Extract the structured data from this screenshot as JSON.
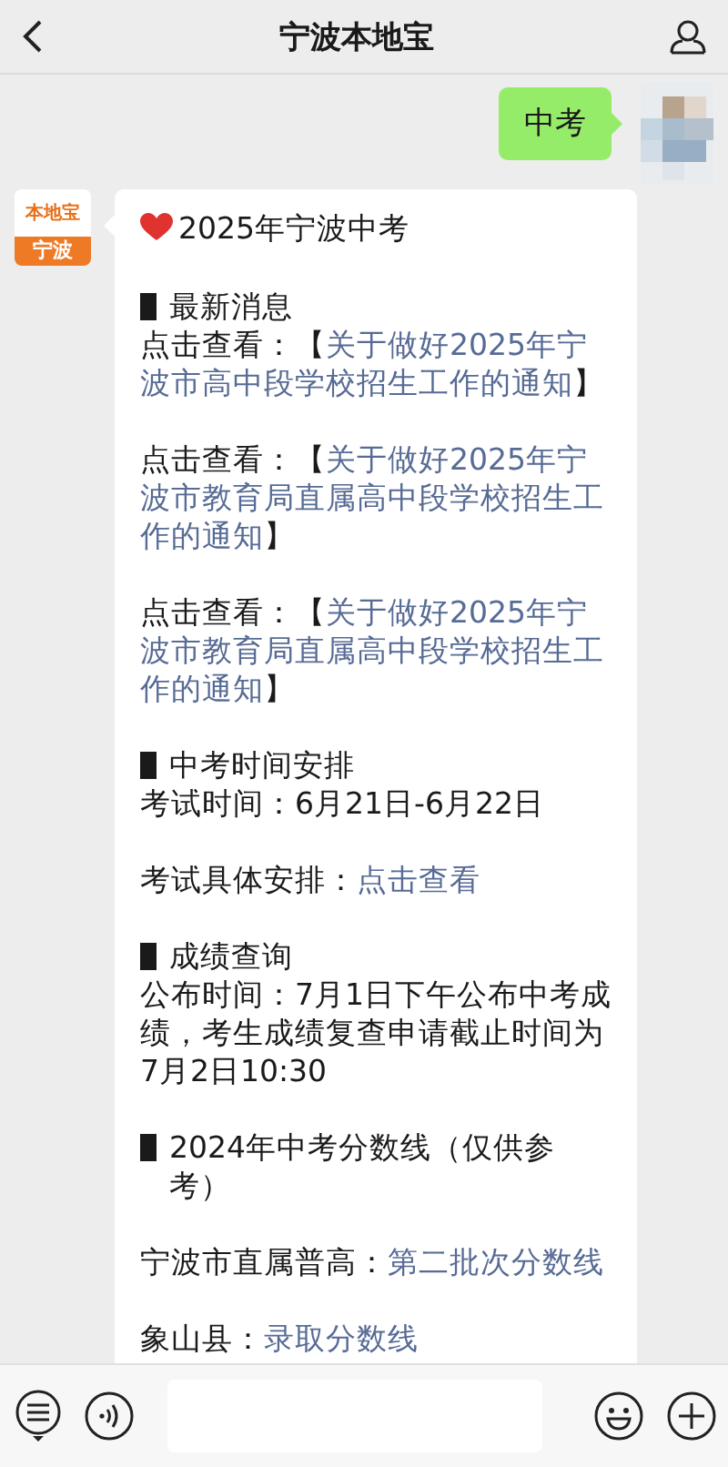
{
  "header": {
    "title": "宁波本地宝"
  },
  "user_message": {
    "text": "中考"
  },
  "bot": {
    "logo_top": "本地宝",
    "logo_bottom": "宁波"
  },
  "message": {
    "title": "2025年宁波中考",
    "blocks": [
      [
        {
          "kind": "heading",
          "text": "最新消息"
        },
        {
          "kind": "paragraph",
          "segments": [
            {
              "kind": "text",
              "text": "点击查看："
            },
            {
              "kind": "text",
              "text": "【"
            },
            {
              "kind": "link",
              "text": "关于做好2025年宁"
            },
            {
              "kind": "link",
              "text": "波市高中段学校招生工作的通知"
            },
            {
              "kind": "text",
              "text": "】"
            }
          ]
        }
      ],
      [
        {
          "kind": "paragraph",
          "segments": [
            {
              "kind": "text",
              "text": "点击查看："
            },
            {
              "kind": "text",
              "text": "【"
            },
            {
              "kind": "link",
              "text": "关于做好2025年宁"
            },
            {
              "kind": "link",
              "text": "波市教育局直属高中段学校招生工"
            },
            {
              "kind": "link",
              "text": "作的通知"
            },
            {
              "kind": "text",
              "text": "】"
            }
          ]
        }
      ],
      [
        {
          "kind": "paragraph",
          "segments": [
            {
              "kind": "text",
              "text": "点击查看："
            },
            {
              "kind": "text",
              "text": "【"
            },
            {
              "kind": "link",
              "text": "关于做好2025年宁"
            },
            {
              "kind": "link",
              "text": "波市教育局直属高中段学校招生工"
            },
            {
              "kind": "link",
              "text": "作的通知"
            },
            {
              "kind": "text",
              "text": "】"
            }
          ]
        }
      ],
      [
        {
          "kind": "heading",
          "text": "中考时间安排"
        },
        {
          "kind": "paragraph",
          "segments": [
            {
              "kind": "text",
              "text": "考试时间：6月21日-6月22日"
            }
          ]
        }
      ],
      [
        {
          "kind": "paragraph",
          "segments": [
            {
              "kind": "text",
              "text": "考试具体安排："
            },
            {
              "kind": "link",
              "text": "点击查看"
            }
          ]
        }
      ],
      [
        {
          "kind": "heading",
          "text": "成绩查询"
        },
        {
          "kind": "paragraph",
          "segments": [
            {
              "kind": "text",
              "text": "公布时间：7月1日下午公布中考成绩，考生成绩复查申请截止时间为7月2日10:30"
            }
          ]
        }
      ],
      [
        {
          "kind": "heading",
          "text": "2024年中考分数线（仅供参考）"
        }
      ],
      [
        {
          "kind": "paragraph",
          "segments": [
            {
              "kind": "text",
              "text": "宁波市直属普高："
            },
            {
              "kind": "link",
              "text": "第二批次分数线"
            }
          ]
        }
      ],
      [
        {
          "kind": "paragraph",
          "segments": [
            {
              "kind": "text",
              "text": "象山县："
            },
            {
              "kind": "link",
              "text": "录取分数线"
            }
          ]
        }
      ]
    ]
  }
}
